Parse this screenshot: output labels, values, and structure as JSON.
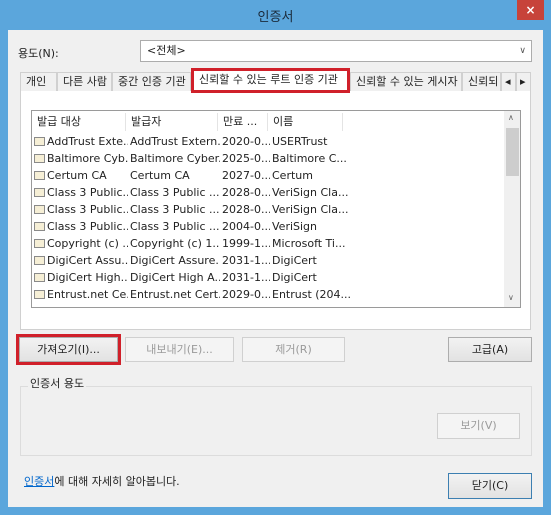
{
  "window": {
    "title": "인증서",
    "close": "×"
  },
  "purpose": {
    "label": "용도(N):",
    "value": "<전체>"
  },
  "tabs": [
    {
      "label": "개인"
    },
    {
      "label": "다른 사람"
    },
    {
      "label": "중간 인증 기관"
    },
    {
      "label": "신뢰할 수 있는 루트 인증 기관",
      "selected": true
    },
    {
      "label": "신뢰할 수 있는 게시자"
    },
    {
      "label": "신뢰되"
    }
  ],
  "tab_scroll": {
    "left": "◂",
    "right": "▸"
  },
  "list": {
    "columns": [
      "발급 대상",
      "발급자",
      "만료 ...",
      "이름"
    ],
    "rows": [
      [
        "AddTrust Exte...",
        "AddTrust Extern...",
        "2020-0...",
        "USERTrust"
      ],
      [
        "Baltimore Cyb...",
        "Baltimore Cyber...",
        "2025-0...",
        "Baltimore C..."
      ],
      [
        "Certum CA",
        "Certum CA",
        "2027-0...",
        "Certum"
      ],
      [
        "Class 3 Public...",
        "Class 3 Public ...",
        "2028-0...",
        "VeriSign Cla..."
      ],
      [
        "Class 3 Public...",
        "Class 3 Public ...",
        "2028-0...",
        "VeriSign Cla..."
      ],
      [
        "Class 3 Public...",
        "Class 3 Public ...",
        "2004-0...",
        "VeriSign"
      ],
      [
        "Copyright (c) ...",
        "Copyright (c) 1...",
        "1999-1...",
        "Microsoft Ti..."
      ],
      [
        "DigiCert Assu...",
        "DigiCert Assure...",
        "2031-1...",
        "DigiCert"
      ],
      [
        "DigiCert High...",
        "DigiCert High A...",
        "2031-1...",
        "DigiCert"
      ],
      [
        "Entrust.net Ce...",
        "Entrust.net Cert...",
        "2029-0...",
        "Entrust (204..."
      ]
    ]
  },
  "buttons": {
    "import": "가져오기(I)...",
    "export": "내보내기(E)...",
    "remove": "제거(R)",
    "advanced": "고급(A)",
    "view": "보기(V)",
    "close": "닫기(C)"
  },
  "group": {
    "label": "인증서 용도"
  },
  "footer": {
    "link": "인증서",
    "text": "에 대해 자세히 알아봅니다."
  },
  "colors": {
    "titlebar": "#5ba6dc",
    "close": "#c7433a",
    "highlight": "#d0202a"
  }
}
